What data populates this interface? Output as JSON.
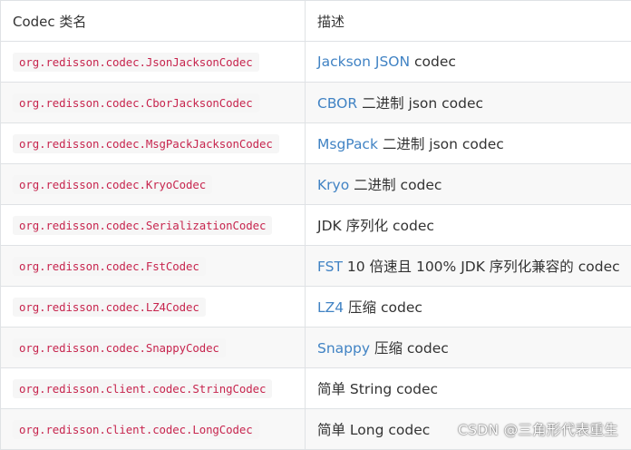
{
  "table": {
    "headers": [
      "Codec 类名",
      "描述"
    ],
    "rows": [
      {
        "class": "org.redisson.codec.JsonJacksonCodec",
        "desc_link": "Jackson JSON",
        "desc_text": " codec"
      },
      {
        "class": "org.redisson.codec.CborJacksonCodec",
        "desc_link": "CBOR",
        "desc_text": " 二进制 json codec"
      },
      {
        "class": "org.redisson.codec.MsgPackJacksonCodec",
        "desc_link": "MsgPack",
        "desc_text": " 二进制 json codec"
      },
      {
        "class": "org.redisson.codec.KryoCodec",
        "desc_link": "Kryo",
        "desc_text": " 二进制 codec"
      },
      {
        "class": "org.redisson.codec.SerializationCodec",
        "desc_link": "",
        "desc_text": "JDK 序列化 codec"
      },
      {
        "class": "org.redisson.codec.FstCodec",
        "desc_link": "FST",
        "desc_text": " 10 倍速且 100% JDK 序列化兼容的 codec"
      },
      {
        "class": "org.redisson.codec.LZ4Codec",
        "desc_link": "LZ4",
        "desc_text": " 压缩 codec"
      },
      {
        "class": "org.redisson.codec.SnappyCodec",
        "desc_link": "Snappy",
        "desc_text": " 压缩 codec"
      },
      {
        "class": "org.redisson.client.codec.StringCodec",
        "desc_link": "",
        "desc_text": "简单 String codec"
      },
      {
        "class": "org.redisson.client.codec.LongCodec",
        "desc_link": "",
        "desc_text": "简单 Long codec"
      }
    ]
  },
  "watermark": "CSDN @三角形代表重生",
  "colors": {
    "link": "#4183c4",
    "code_text": "#c7254e",
    "code_bg": "#f6f6f6",
    "row_stripe": "#f8f8f8",
    "border": "#dfe2e5"
  }
}
